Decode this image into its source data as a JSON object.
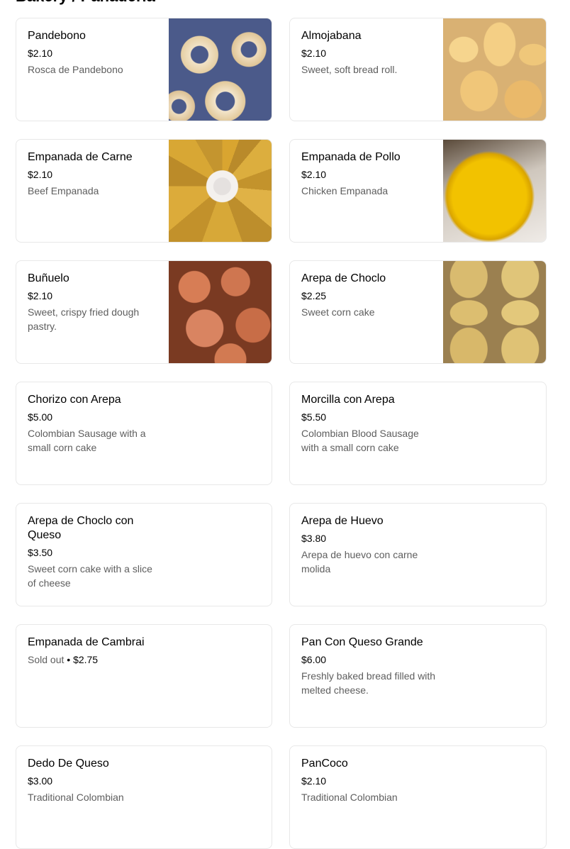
{
  "section": {
    "title": "Bakery / Panaderia"
  },
  "items": [
    {
      "name": "Pandebono",
      "price": "$2.10",
      "description": "Rosca de Pandebono",
      "image": "pandebono"
    },
    {
      "name": "Almojabana",
      "price": "$2.10",
      "description": "Sweet, soft bread roll.",
      "image": "almojabana"
    },
    {
      "name": "Empanada de Carne",
      "price": "$2.10",
      "description": "Beef Empanada",
      "image": "carne"
    },
    {
      "name": "Empanada de Pollo",
      "price": "$2.10",
      "description": "Chicken Empanada",
      "image": "pollo"
    },
    {
      "name": "Buñuelo",
      "price": "$2.10",
      "description": "Sweet, crispy fried dough pastry.",
      "image": "bunuelo"
    },
    {
      "name": "Arepa de Choclo",
      "price": "$2.25",
      "description": "Sweet corn cake",
      "image": "choclo"
    },
    {
      "name": "Chorizo con Arepa",
      "price": "$5.00",
      "description": "Colombian Sausage with a small corn cake"
    },
    {
      "name": "Morcilla con Arepa",
      "price": "$5.50",
      "description": "Colombian Blood Sausage with a small corn cake"
    },
    {
      "name": "Arepa de Choclo con Queso",
      "price": "$3.50",
      "description": "Sweet corn cake with a slice of cheese"
    },
    {
      "name": "Arepa de Huevo",
      "price": "$3.80",
      "description": "Arepa de huevo con carne molida"
    },
    {
      "name": "Empanada de Cambrai",
      "price": "$2.75",
      "status": "Sold out",
      "separator": " • "
    },
    {
      "name": "Pan Con Queso Grande",
      "price": "$6.00",
      "description": "Freshly baked bread filled with melted cheese."
    },
    {
      "name": "Dedo De Queso",
      "price": "$3.00",
      "description": "Traditional Colombian"
    },
    {
      "name": "PanCoco",
      "price": "$2.10",
      "description": "Traditional Colombian"
    }
  ]
}
